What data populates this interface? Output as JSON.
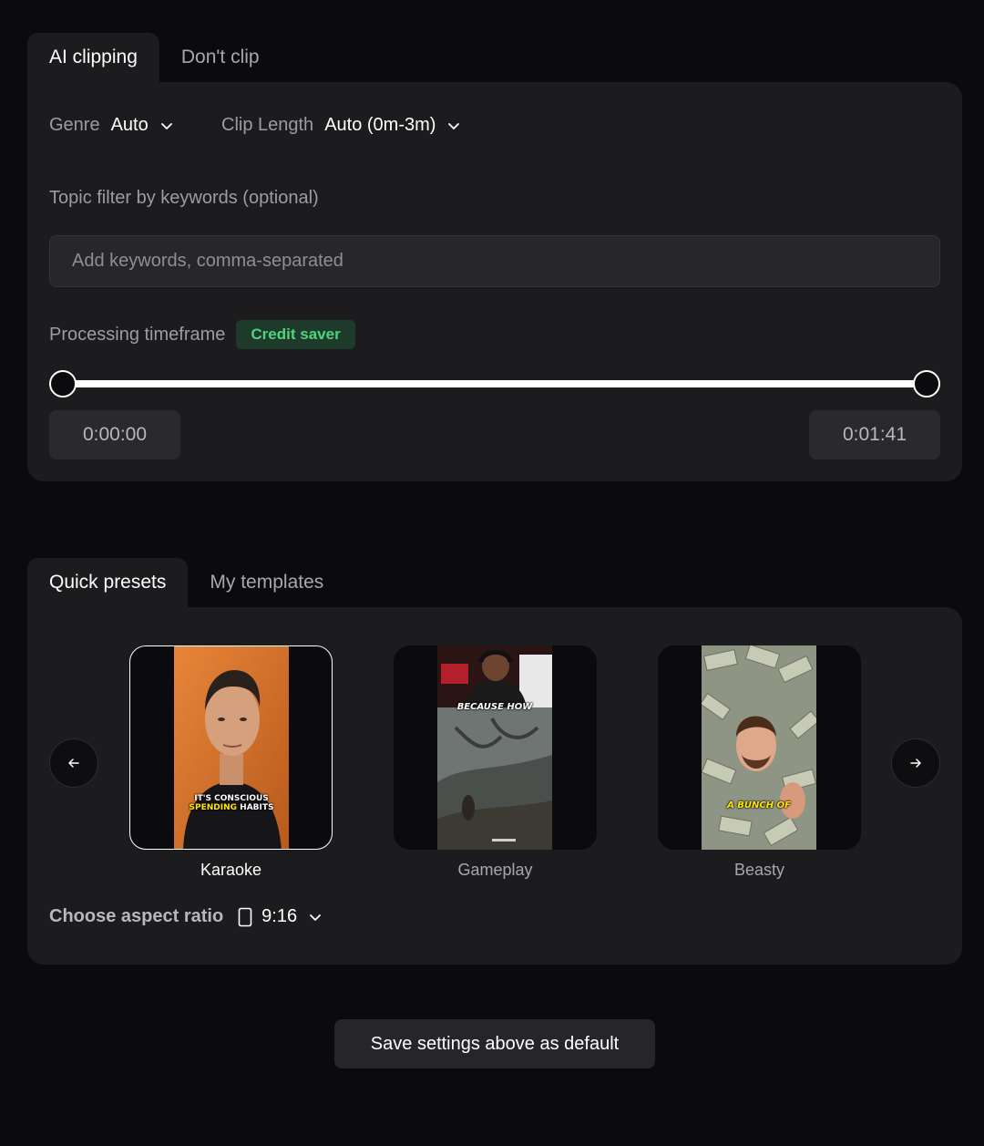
{
  "clip_tabs": [
    {
      "label": "AI clipping",
      "active": true
    },
    {
      "label": "Don't clip",
      "active": false
    }
  ],
  "settings": {
    "genre_label": "Genre",
    "genre_value": "Auto",
    "clip_length_label": "Clip Length",
    "clip_length_value": "Auto (0m-3m)",
    "topic_filter_label": "Topic filter by keywords (optional)",
    "keywords_placeholder": "Add keywords, comma-separated",
    "keywords_value": "",
    "timeframe_label": "Processing timeframe",
    "timeframe_badge": "Credit saver",
    "time_start": "0:00:00",
    "time_end": "0:01:41"
  },
  "preset_tabs": [
    {
      "label": "Quick presets",
      "active": true
    },
    {
      "label": "My templates",
      "active": false
    }
  ],
  "presets": [
    {
      "label": "Karaoke",
      "selected": true,
      "caption_lines": [
        "IT'S CONSCIOUS",
        "SPENDING",
        "HABITS"
      ]
    },
    {
      "label": "Gameplay",
      "selected": false,
      "caption_lines": [
        "BECAUSE HOW"
      ]
    },
    {
      "label": "Beasty",
      "selected": false,
      "caption_lines": [
        "A BUNCH OF"
      ]
    }
  ],
  "aspect": {
    "label": "Choose aspect ratio",
    "value": "9:16"
  },
  "save_button": "Save settings above as default",
  "colors": {
    "background": "#0b0b0d",
    "panel": "#1c1c1f",
    "badge_text": "#4fd37e",
    "badge_bg": "#1e3a2b",
    "caption_highlight": "#ffe600"
  }
}
